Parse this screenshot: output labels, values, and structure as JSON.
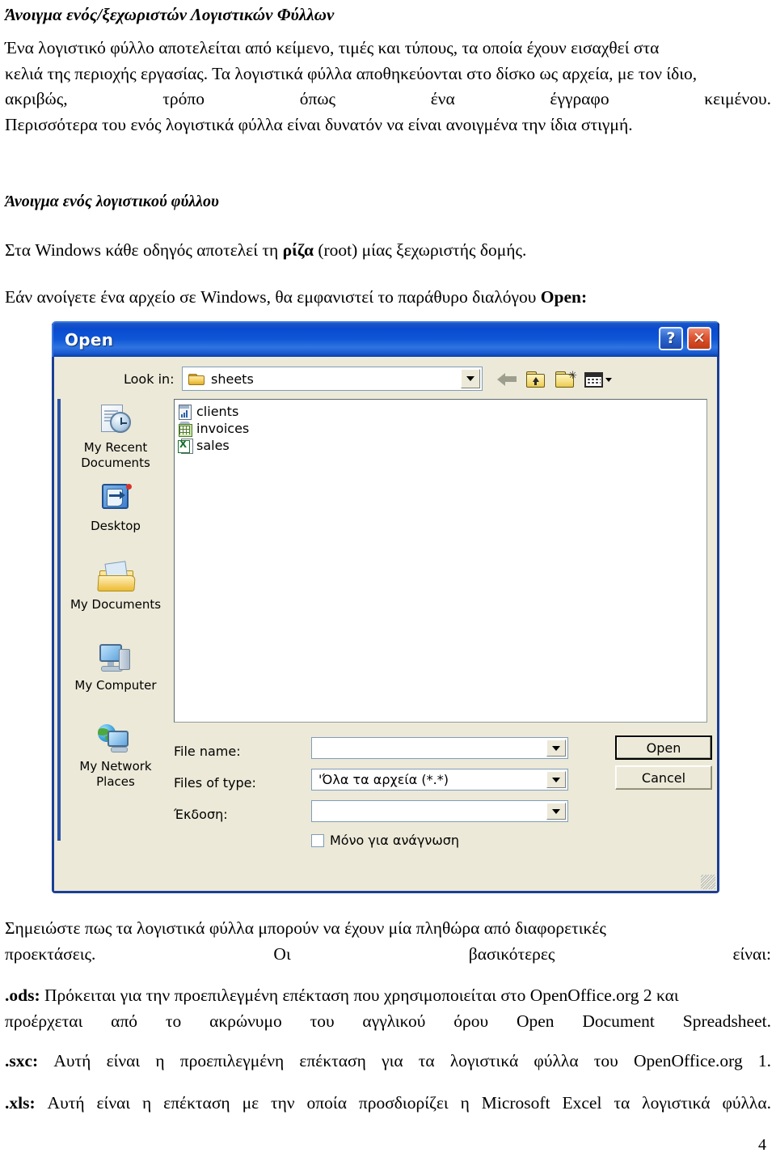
{
  "document": {
    "heading1": "Άνοιγμα ενός/ξεχωριστών Λογιστικών Φύλλων",
    "para1_line1": "Ένα λογιστικό φύλλο αποτελείται από κείμενο, τιμές και τύπους, τα οποία έχουν εισαχθεί στα",
    "para1_line2": "κελιά της περιοχής εργασίας. Τα λογιστικά φύλλα αποθηκεύονται στο δίσκο ως αρχεία, με τον ίδιο,",
    "para1_line3": "ακριβώς, τρόπο όπως ένα έγγραφο κειμένου.",
    "para1_line4": "Περισσότερα του ενός λογιστικά φύλλα είναι δυνατόν να είναι ανοιγμένα την ίδια στιγμή.",
    "heading2": "Άνοιγμα ενός λογιστικού φύλλου",
    "para2_prefix": "Στα Windows κάθε οδηγός αποτελεί τη ",
    "para2_bold": "ρίζα",
    "para2_suffix": " (root) μίας ξεχωριστής δομής.",
    "para3_prefix": "Εάν ανοίγετε ένα αρχείο σε Windows, θα εμφανιστεί το παράθυρο διαλόγου ",
    "para3_bold": "Open:",
    "para4_line1": "Σημειώστε πως τα λογιστικά φύλλα μπορούν να έχουν μία πληθώρα από διαφορετικές",
    "para4_line2": "προεκτάσεις. Οι βασικότερες είναι:",
    "ext_ods_label": ".ods:",
    "ext_ods_line1": " Πρόκειται για την προεπιλεγμένη επέκταση που χρησιμοποιείται στο OpenOffice.org 2 και",
    "ext_ods_line2": "προέρχεται από το ακρώνυμο του αγγλικού όρου Open Document Spreadsheet.",
    "ext_sxc_label": ".sxc:",
    "ext_sxc_text": " Αυτή είναι η προεπιλεγμένη επέκταση για τα λογιστικά φύλλα του OpenOffice.org 1.",
    "ext_xls_label": ".xls:",
    "ext_xls_text": " Αυτή είναι η επέκταση με την οποία προσδιορίζει η Microsoft Excel τα λογιστικά φύλλα.",
    "page_number": "4"
  },
  "dialog": {
    "title": "Open",
    "help_glyph": "?",
    "close_glyph": "✕",
    "lookin_label": "Look in:",
    "lookin_value": "sheets",
    "toolbar": {
      "back_name": "back-icon",
      "up_name": "up-one-level-icon",
      "new_folder_name": "new-folder-icon",
      "views_name": "views-menu-icon"
    },
    "places": [
      {
        "label_line1": "My Recent",
        "label_line2": "Documents",
        "icon": "recent-documents-icon"
      },
      {
        "label_line1": "Desktop",
        "label_line2": "",
        "icon": "desktop-icon"
      },
      {
        "label_line1": "My Documents",
        "label_line2": "",
        "icon": "my-documents-icon"
      },
      {
        "label_line1": "My Computer",
        "label_line2": "",
        "icon": "my-computer-icon"
      },
      {
        "label_line1": "My Network",
        "label_line2": "Places",
        "icon": "my-network-places-icon"
      }
    ],
    "files": [
      {
        "name": "clients",
        "icon": "spreadsheet-chart-icon"
      },
      {
        "name": "invoices",
        "icon": "spreadsheet-green-grid-icon"
      },
      {
        "name": "sales",
        "icon": "excel-file-icon"
      }
    ],
    "form": {
      "filename_label": "File name:",
      "filename_value": "",
      "filetype_label": "Files of type:",
      "filetype_value": "'Όλα τα αρχεία (*.*)",
      "version_label": "Έκδοση:",
      "version_value": "",
      "readonly_label": "Μόνο για ανάγνωση",
      "readonly_checked": false
    },
    "buttons": {
      "open": "Open",
      "cancel": "Cancel"
    },
    "colors": {
      "titlebar_blue": "#0a4bd0",
      "window_border": "#1c3f94",
      "face": "#ece9d8",
      "close_red": "#df5430",
      "placesbar_rule": "#2b53a8"
    }
  }
}
